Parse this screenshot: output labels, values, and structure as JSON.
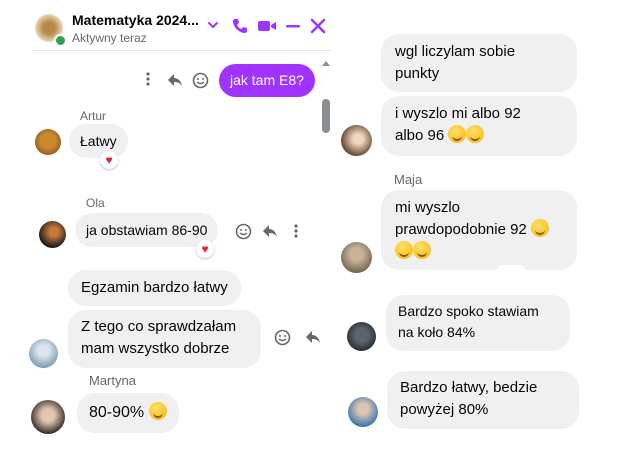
{
  "header": {
    "chat_title": "Matematyka 2024...",
    "status": "Aktywny teraz"
  },
  "left": {
    "outgoing": {
      "text": "jak tam E8?"
    },
    "messages": [
      {
        "sender": "Artur",
        "text": "Łatwy",
        "reaction": "♥"
      },
      {
        "sender": "Ola",
        "text": "ja obstawiam 86-90",
        "reaction": "♥"
      },
      {
        "sender": "",
        "text": "Egzamin bardzo łatwy"
      },
      {
        "sender": "",
        "line1": "Z tego co sprawdzałam",
        "line2": "mam wszystko dobrze"
      },
      {
        "sender": "Martyna",
        "text": "80-90%"
      }
    ]
  },
  "right": {
    "messages": [
      {
        "line1": "wgl liczylam sobie",
        "line2": "punkty"
      },
      {
        "line1": "i wyszlo mi albo 92",
        "line2": "albo 96"
      },
      {
        "sender": "Maja",
        "line1": "mi wyszlo",
        "line2": "prawdopodobnie 92"
      },
      {
        "line1": "Bardzo spoko stawiam",
        "line2": "na koło 84%"
      },
      {
        "line1": "Bardzo łatwy, bedzie",
        "line2": "powyżej 80%"
      }
    ]
  },
  "colors": {
    "accent": "#a033ff",
    "outgoing_bubble": "#a033ff",
    "incoming_bubble": "#f0f0f0"
  },
  "icons": [
    "chevron-down-icon",
    "phone-icon",
    "video-icon",
    "minimize-icon",
    "close-icon",
    "more-icon",
    "reply-icon",
    "smile-icon"
  ]
}
